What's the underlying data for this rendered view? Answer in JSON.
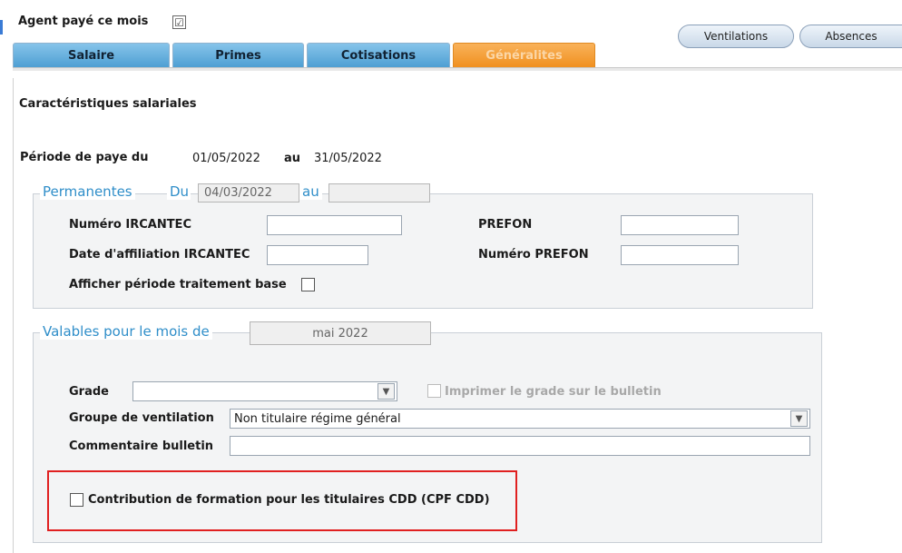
{
  "header": {
    "agent_label": "Agent payé ce mois",
    "agent_checked_glyph": "☑"
  },
  "tabs": [
    {
      "label": "Salaire",
      "active": false
    },
    {
      "label": "Primes",
      "active": false
    },
    {
      "label": "Cotisations",
      "active": false
    },
    {
      "label": "Généralites",
      "active": true
    }
  ],
  "buttons": {
    "ventilations": "Ventilations",
    "absences": "Absences"
  },
  "main": {
    "section_title": "Caractéristiques salariales",
    "periode_label": "Période de paye du",
    "periode_from": "01/05/2022",
    "periode_au": "au",
    "periode_to": "31/05/2022"
  },
  "permanentes": {
    "legend": "Permanentes",
    "du_label": "Du",
    "du_value": "04/03/2022",
    "au_label": "au",
    "au_value": "",
    "numero_ircantec_label": "Numéro IRCANTEC",
    "numero_ircantec_value": "",
    "date_affiliation_label": "Date d'affiliation IRCANTEC",
    "date_affiliation_value": "",
    "prefon_label": "PREFON",
    "prefon_value": "",
    "numero_prefon_label": "Numéro PREFON",
    "numero_prefon_value": "",
    "afficher_label": "Afficher période traitement base"
  },
  "valables": {
    "legend": "Valables pour le mois de",
    "mois_value": "mai 2022",
    "grade_label": "Grade",
    "grade_value": "",
    "imprimer_label": "Imprimer le grade sur le bulletin",
    "groupe_label": "Groupe de ventilation",
    "groupe_value": "Non titulaire régime général",
    "commentaire_label": "Commentaire bulletin",
    "commentaire_value": "",
    "contribution_label": "Contribution de formation pour les titulaires CDD (CPF CDD)"
  },
  "colors": {
    "tab_blue": "#4e9fd3",
    "tab_active_orange": "#f0901f",
    "legend_blue": "#2f8ec9",
    "highlight_red": "#e02020"
  }
}
